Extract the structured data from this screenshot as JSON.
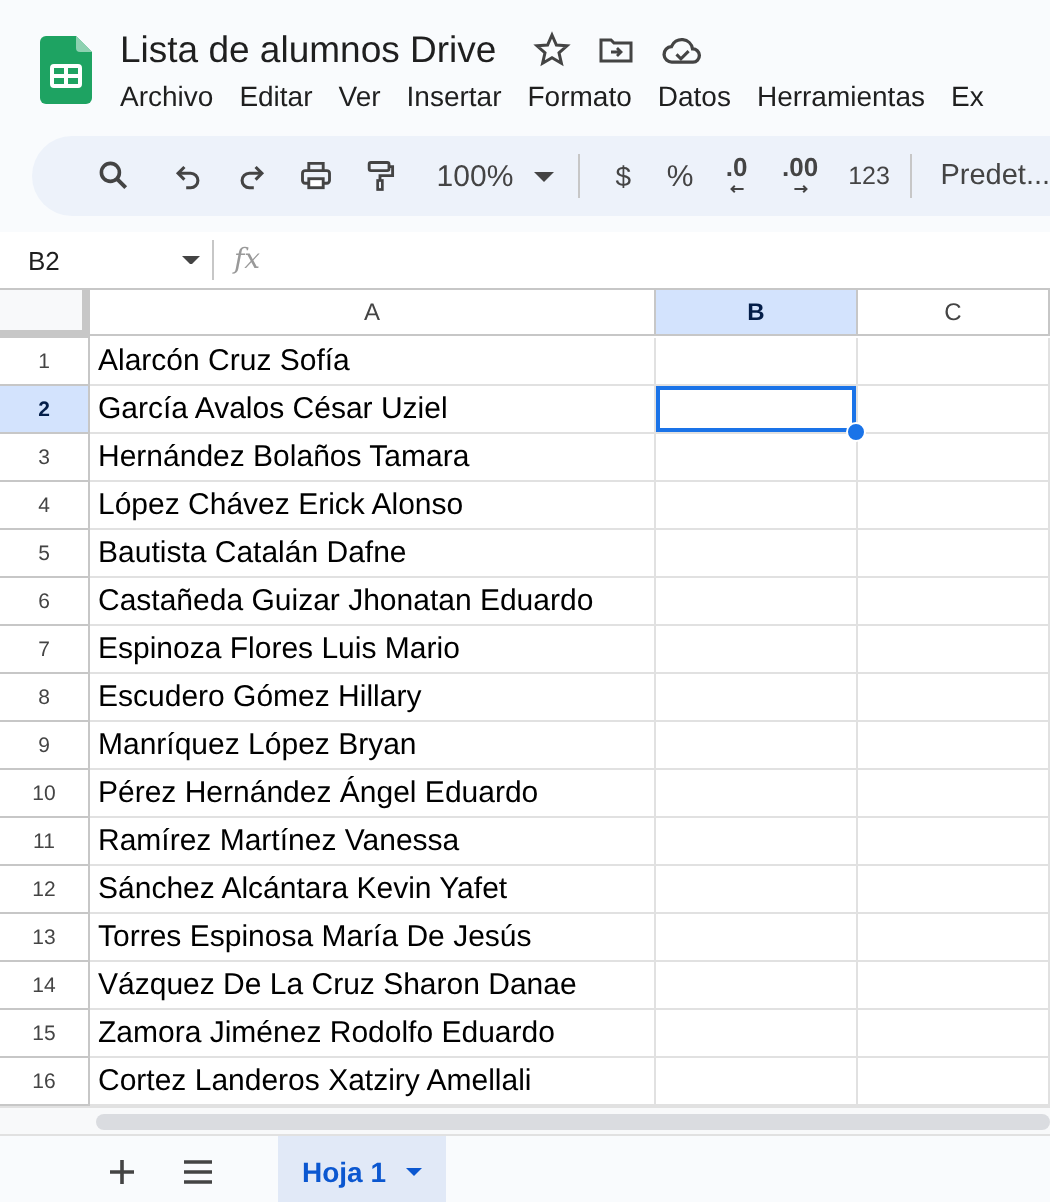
{
  "document": {
    "title": "Lista de alumnos Drive"
  },
  "menu": [
    "Archivo",
    "Editar",
    "Ver",
    "Insertar",
    "Formato",
    "Datos",
    "Herramientas",
    "Ex"
  ],
  "toolbar": {
    "zoom": "100%",
    "currency": "$",
    "percent": "%",
    "decrease_decimals": ".0",
    "increase_decimals": ".00",
    "number_format": "123",
    "font": "Predet..."
  },
  "formula_bar": {
    "name_box": "B2",
    "fx": "fx"
  },
  "columns": [
    {
      "label": "A",
      "selected": false
    },
    {
      "label": "B",
      "selected": true
    },
    {
      "label": "C",
      "selected": false
    }
  ],
  "rows": [
    {
      "label": "1",
      "selected": false,
      "cell_a": "Alarcón Cruz Sofía"
    },
    {
      "label": "2",
      "selected": true,
      "cell_a": "García Avalos César Uziel"
    },
    {
      "label": "3",
      "selected": false,
      "cell_a": "Hernández Bolaños Tamara"
    },
    {
      "label": "4",
      "selected": false,
      "cell_a": "López Chávez Erick Alonso"
    },
    {
      "label": "5",
      "selected": false,
      "cell_a": "Bautista Catalán Dafne"
    },
    {
      "label": "6",
      "selected": false,
      "cell_a": "Castañeda Guizar Jhonatan Eduardo"
    },
    {
      "label": "7",
      "selected": false,
      "cell_a": "Espinoza Flores Luis Mario"
    },
    {
      "label": "8",
      "selected": false,
      "cell_a": "Escudero Gómez Hillary"
    },
    {
      "label": "9",
      "selected": false,
      "cell_a": "Manríquez López Bryan"
    },
    {
      "label": "10",
      "selected": false,
      "cell_a": "Pérez Hernández Ángel Eduardo"
    },
    {
      "label": "11",
      "selected": false,
      "cell_a": "Ramírez Martínez Vanessa"
    },
    {
      "label": "12",
      "selected": false,
      "cell_a": "Sánchez Alcántara Kevin Yafet"
    },
    {
      "label": "13",
      "selected": false,
      "cell_a": "Torres Espinosa María De Jesús"
    },
    {
      "label": "14",
      "selected": false,
      "cell_a": "Vázquez De La Cruz Sharon Danae"
    },
    {
      "label": "15",
      "selected": false,
      "cell_a": "Zamora Jiménez Rodolfo Eduardo"
    },
    {
      "label": "16",
      "selected": false,
      "cell_a": "Cortez Landeros Xatziry Amellali"
    }
  ],
  "sheet_tabs": [
    {
      "label": "Hoja 1",
      "selected": true
    }
  ]
}
